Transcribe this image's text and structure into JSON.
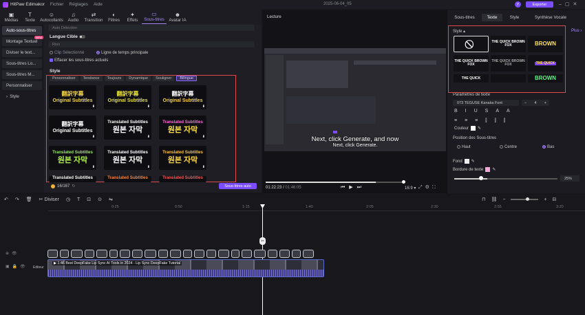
{
  "app": {
    "title": "HitPaw Edimakor",
    "menus": [
      "Fichier",
      "Réglages",
      "Aide"
    ],
    "date": "2025-06-04_05",
    "export_label": "Exporter",
    "avatar_letter": "Y"
  },
  "toolbar": {
    "tools": [
      {
        "label": "Médias",
        "icon": "▣"
      },
      {
        "label": "Texte",
        "icon": "T"
      },
      {
        "label": "Autocollants",
        "icon": "☺"
      },
      {
        "label": "Audio",
        "icon": "♫"
      },
      {
        "label": "Transition",
        "icon": "⇄"
      },
      {
        "label": "Filtres",
        "icon": "◐"
      },
      {
        "label": "Effets",
        "icon": "✦"
      },
      {
        "label": "Sous-titres",
        "icon": "▭"
      },
      {
        "label": "Avatar IA",
        "icon": "☻"
      }
    ]
  },
  "sidebar": {
    "items": [
      "Auto-sous-titres",
      "Montage Textuel",
      "Diviser le text...",
      "Sous-titres Lo...",
      "Sous-titres M...",
      "Personnaliser",
      "Style"
    ],
    "new_badge": "NEW"
  },
  "panel": {
    "auto_detection": "Auto Détection",
    "target_lang_label": "Langue Cible",
    "target_lang_value": "Rien",
    "clip_option": "Clip Sélectionné",
    "timeline_option": "Ligne de temps principale",
    "erase_label": "Effacer les sous-titres actuels",
    "style_label": "Style",
    "style_tabs": [
      "Personnaliser",
      "Tendance",
      "Toujours",
      "Dynamique",
      "Souligner",
      "Bilingue"
    ],
    "tiles": [
      {
        "l1": "翻訳字幕",
        "l2": "Original Subtitles",
        "c1": "#f7d84a",
        "c2": "#f7d84a"
      },
      {
        "l1": "翻訳字幕",
        "l2": "Original Subtitles",
        "c1": "#e8e13b",
        "c2": "#e8e13b"
      },
      {
        "l1": "翻訳字幕",
        "l2": "Original Subtitles",
        "c1": "#ffffff",
        "c2": "#ffd23a"
      },
      {
        "l1": "翻訳字幕",
        "l2": "Original Subtitles",
        "c1": "#ffffff",
        "c2": "#ffffff"
      },
      {
        "l1": "Translated Subtitles",
        "l2": "원본 자막",
        "c1": "#ffffff",
        "c2": "#ffffff"
      },
      {
        "l1": "Translated Subtitles",
        "l2": "원본 자막",
        "c1": "#ff6bd8",
        "c2": "#ffe14a"
      },
      {
        "l1": "Translated Subtitles",
        "l2": "원본 자막",
        "c1": "#9be86a",
        "c2": "#b2f04d"
      },
      {
        "l1": "Translated Subtitles",
        "l2": "원본 자막",
        "c1": "#ffffff",
        "c2": "#ffffff"
      },
      {
        "l1": "Translated Subtitles",
        "l2": "원본 자막",
        "c1": "#ffc43a",
        "c2": "#ffd84a"
      },
      {
        "l1": "Translated Subtitles",
        "l2": "",
        "c1": "#ffffff",
        "c2": "#ffffff"
      },
      {
        "l1": "Translated Subtitles",
        "l2": "",
        "c1": "#ff8a3a",
        "c2": "#ff8a3a"
      },
      {
        "l1": "Translated Subtitles",
        "l2": "",
        "c1": "#ff5a5a",
        "c2": "#ff5a5a"
      }
    ],
    "credits": "16/167",
    "auto_btn": "Sous-titres auto"
  },
  "preview": {
    "label": "Lecture",
    "caption1": "Next, click Generate, and now",
    "caption2": "Next, click Generate.",
    "time_current": "01:22:23",
    "time_total": "01:46:05",
    "ratio": "16:9",
    "progress": 0.8
  },
  "right": {
    "tabs": [
      "Sous-titres",
      "Texte",
      "Style",
      "Synthèse Vocale"
    ],
    "style_label": "Style",
    "plus": "Plus",
    "style_tiles": [
      {
        "t": "⃠",
        "c": "#ffffff",
        "sel": true
      },
      {
        "t": "THE QUICK BROWN FOX",
        "c": "#ffffff"
      },
      {
        "t": "BROWN",
        "c": "#ffe14a"
      },
      {
        "t": "THE QUICK BROWN FOX",
        "c": "#ffffff"
      },
      {
        "t": "THE QUICK BROWN FOX",
        "c": "#aaaaaa"
      },
      {
        "t": "THE QUICK",
        "c": "#ffe14a"
      },
      {
        "t": "THE QUICK",
        "c": "#ffffff"
      },
      {
        "t": "",
        "c": "#ffffff"
      },
      {
        "t": "BROWN",
        "c": "#4dff7a"
      }
    ],
    "text_params": "Paramètres de texte",
    "font": "073 TEGUSE  Kanaka Font",
    "font_size": "4",
    "color_label": "Couleur",
    "position_label": "Position des Sous-titres",
    "positions": [
      "Haut",
      "Centre",
      "Bas"
    ],
    "bg_label": "Fond",
    "border_label": "Bordure de texte",
    "opacity": "25%"
  },
  "timeline": {
    "split_label": "Diviser",
    "ticks": [
      "0:25",
      "0:50",
      "1:15",
      "1:40",
      "2:05",
      "2:30",
      "2:55",
      "3:20",
      "3:45"
    ],
    "clip_title": "1:46 Best DeepFake Lip Sync AI Tools in 2024 - Lip Sync DeepFake Tutorial",
    "track_label": "Editeur"
  }
}
